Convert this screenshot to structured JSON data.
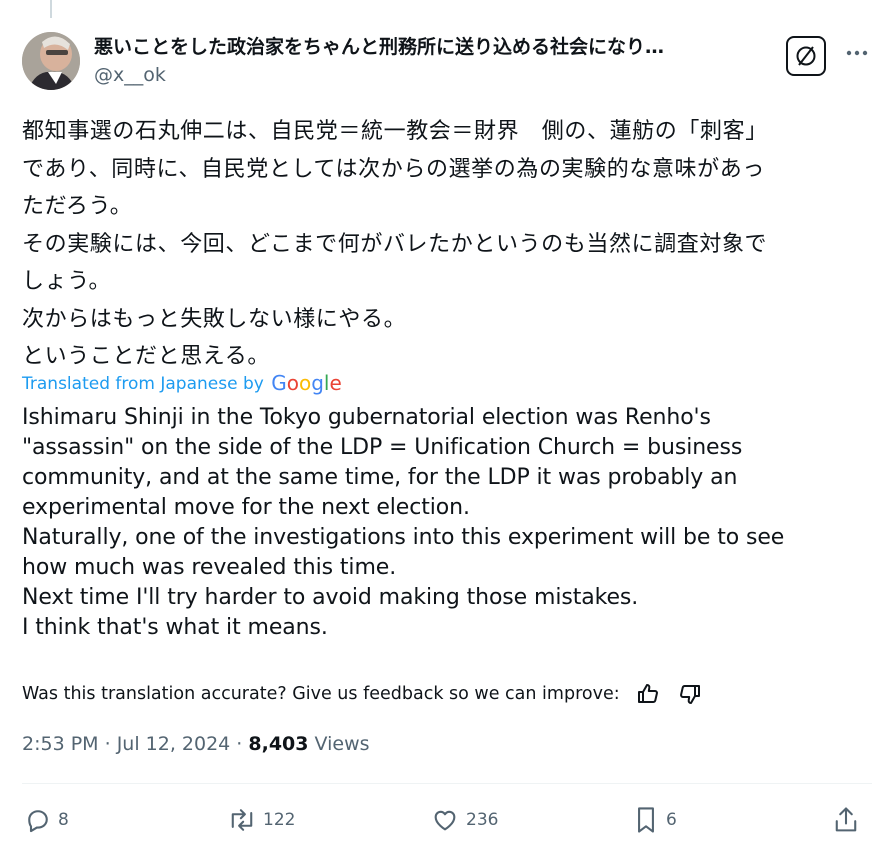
{
  "author": {
    "display_name": "悪いことをした政治家をちゃんと刑務所に送り込める社会になり…",
    "handle": "@x__ok"
  },
  "tweet": {
    "jp_lines": [
      "都知事選の石丸伸二は、自民党＝統一教会＝財界　側の、蓮舫の「刺客」",
      "であり、同時に、自民党としては次からの選挙の為の実験的な意味があっ",
      "ただろう。",
      "その実験には、今回、どこまで何がバレたかというのも当然に調査対象で",
      "しょう。",
      "次からはもっと失敗しない様にやる。",
      "ということだと思える。"
    ],
    "translated_label": "Translated from Japanese by",
    "google_logo": "Google",
    "en_lines": [
      "Ishimaru Shinji in the Tokyo gubernatorial election was Renho's",
      "\"assassin\" on the side of the LDP = Unification Church = business",
      "community, and at the same time, for the LDP it was probably an",
      "experimental move for the next election.",
      "Naturally, one of the investigations into this experiment will be to see",
      "how much was revealed this time.",
      "Next time I'll try harder to avoid making those mistakes.",
      "I think that's what it means."
    ],
    "feedback_prompt": "Was this translation accurate? Give us feedback so we can improve:"
  },
  "meta": {
    "time": "2:53 PM",
    "sep1": " · ",
    "date": "Jul 12, 2024",
    "sep2": " · ",
    "views_count": "8,403",
    "views_label": " Views"
  },
  "actions": {
    "replies": "8",
    "reposts": "122",
    "likes": "236",
    "bookmarks": "6"
  },
  "colors": {
    "link_blue": "#1d9bf0",
    "muted": "#536471",
    "text": "#0f1419"
  },
  "icons": [
    "reply-icon",
    "repost-icon",
    "like-icon",
    "bookmark-icon",
    "share-icon",
    "thumbs-up-icon",
    "thumbs-down-icon",
    "more-icon",
    "badge-icon"
  ]
}
